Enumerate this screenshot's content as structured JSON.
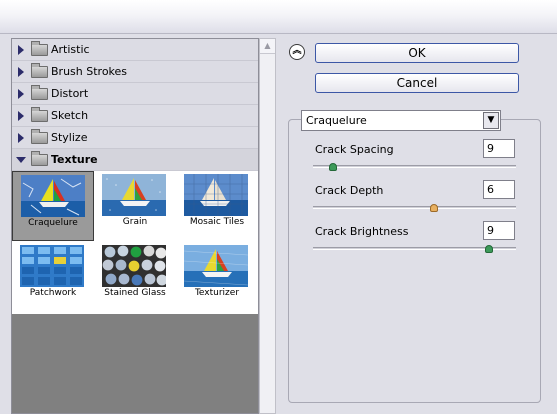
{
  "categories": [
    {
      "label": "Artistic",
      "expanded": false
    },
    {
      "label": "Brush Strokes",
      "expanded": false
    },
    {
      "label": "Distort",
      "expanded": false
    },
    {
      "label": "Sketch",
      "expanded": false
    },
    {
      "label": "Stylize",
      "expanded": false
    },
    {
      "label": "Texture",
      "expanded": true
    }
  ],
  "filters": [
    {
      "label": "Craquelure",
      "selected": true
    },
    {
      "label": "Grain",
      "selected": false
    },
    {
      "label": "Mosaic Tiles",
      "selected": false
    },
    {
      "label": "Patchwork",
      "selected": false
    },
    {
      "label": "Stained Glass",
      "selected": false
    },
    {
      "label": "Texturizer",
      "selected": false
    }
  ],
  "buttons": {
    "ok": "OK",
    "cancel": "Cancel"
  },
  "current_filter": "Craquelure",
  "params": [
    {
      "label": "Crack Spacing",
      "value": "9",
      "slider_fraction": 0.08
    },
    {
      "label": "Crack Depth",
      "value": "6",
      "slider_fraction": 0.6
    },
    {
      "label": "Crack Brightness",
      "value": "9",
      "slider_fraction": 0.88
    }
  ],
  "colors": {
    "selection_border": "#3c57a6",
    "tree_triangle": "#2c2c6a"
  }
}
